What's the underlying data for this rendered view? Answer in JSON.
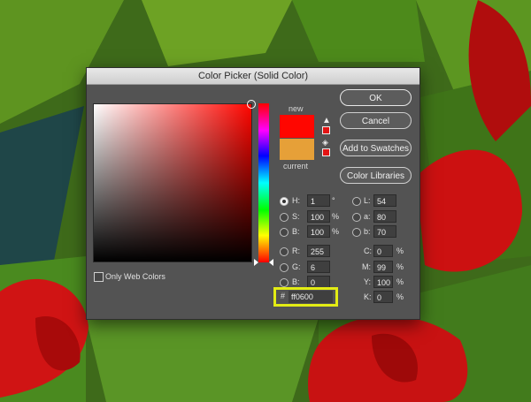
{
  "dialog": {
    "title": "Color Picker (Solid Color)"
  },
  "preview": {
    "new_label": "new",
    "current_label": "current",
    "new_color": "#ff0600",
    "current_color": "#e6a038"
  },
  "icons": {
    "gamut_warning": "warning-triangle-icon",
    "web_safe": "cube-icon"
  },
  "buttons": {
    "ok": "OK",
    "cancel": "Cancel",
    "add_to_swatches": "Add to Swatches",
    "color_libraries": "Color Libraries"
  },
  "only_web_colors": {
    "label": "Only Web Colors",
    "checked": false
  },
  "hsb": {
    "h": {
      "label": "H:",
      "value": "1",
      "unit": "°",
      "selected": true
    },
    "s": {
      "label": "S:",
      "value": "100",
      "unit": "%"
    },
    "b": {
      "label": "B:",
      "value": "100",
      "unit": "%"
    }
  },
  "rgb": {
    "r": {
      "label": "R:",
      "value": "255"
    },
    "g": {
      "label": "G:",
      "value": "6"
    },
    "b": {
      "label": "B:",
      "value": "0"
    }
  },
  "lab": {
    "l": {
      "label": "L:",
      "value": "54"
    },
    "a": {
      "label": "a:",
      "value": "80"
    },
    "b": {
      "label": "b:",
      "value": "70"
    }
  },
  "cmyk": {
    "c": {
      "label": "C:",
      "value": "0",
      "unit": "%"
    },
    "m": {
      "label": "M:",
      "value": "99",
      "unit": "%"
    },
    "y": {
      "label": "Y:",
      "value": "100",
      "unit": "%"
    },
    "k": {
      "label": "K:",
      "value": "0",
      "unit": "%"
    }
  },
  "hex": {
    "hash": "#",
    "value": "ff0600"
  },
  "colors": {
    "highlight": "#e3ec14",
    "dialog_bg": "#535353"
  }
}
